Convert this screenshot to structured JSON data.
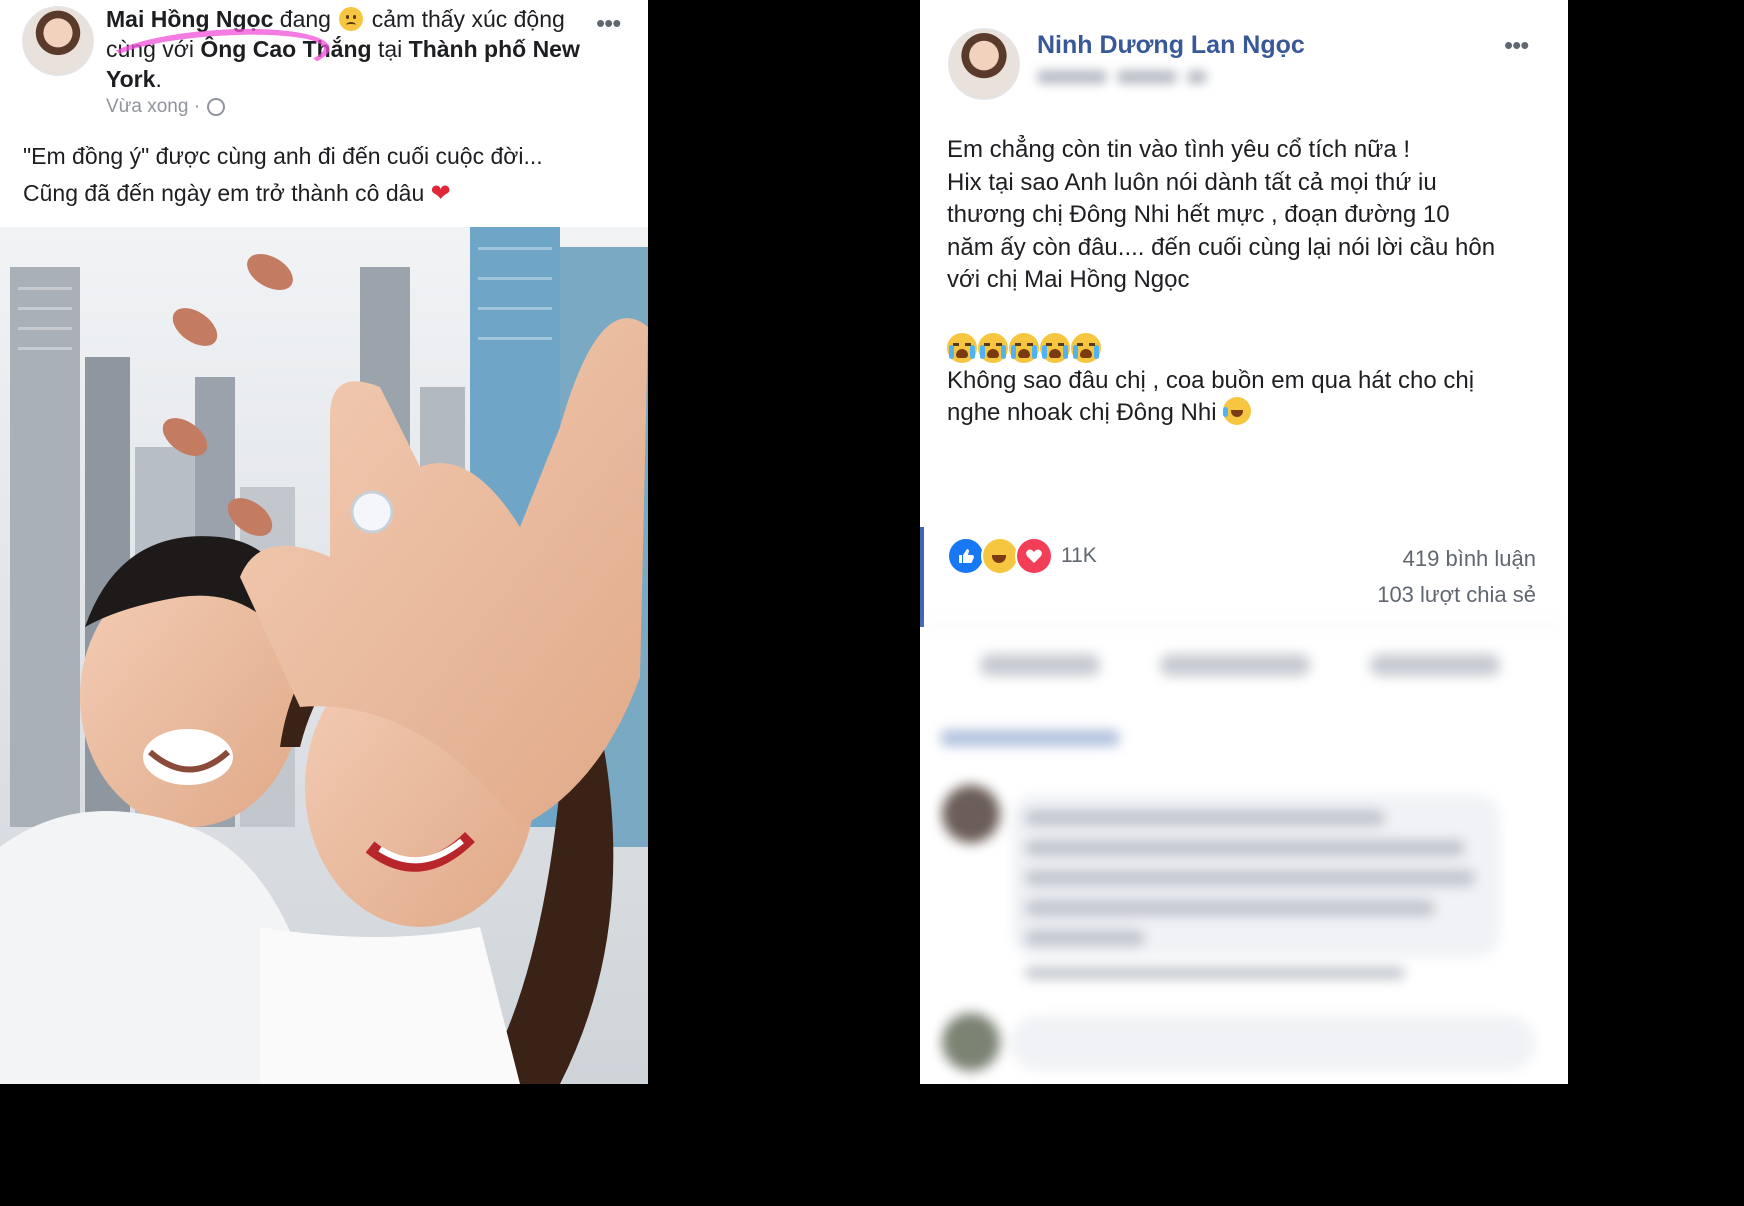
{
  "left_post": {
    "author": "Mai Hồng Ngọc",
    "feeling_prefix": "đang",
    "feeling_text": "cảm thấy xúc động",
    "with_text": "cùng với",
    "tagged": "Ông Cao Thắng",
    "at_text": "tại",
    "location": "Thành phố New York",
    "time": "Vừa xong",
    "separator": "·",
    "lines": [
      "\"Em đồng ý\" được cùng anh đi đến cuối cuộc đời...",
      "Cũng đã đến ngày em trở thành cô dâu"
    ],
    "heart": "❤",
    "more_icon": "•••"
  },
  "right_post": {
    "author": "Ninh Dương Lan Ngọc",
    "more_icon": "•••",
    "paragraph1": [
      "Em chẳng còn tin vào tình yêu cổ tích nữa !",
      "Hix tại sao Anh luôn nói dành tất cả mọi thứ iu",
      "thương chị Đông Nhi hết mực , đoạn đường 10",
      "năm ấy còn đâu.... đến cuối cùng lại nói lời cầu hôn",
      "với chị Mai Hồng Ngọc"
    ],
    "paragraph2": [
      "Không sao đâu chị , coa buồn em qua hát cho chị",
      "nghe nhoak chị Đông Nhi"
    ],
    "reaction_count": "11K",
    "comments": "419 bình luận",
    "shares": "103 lượt chia sẻ"
  },
  "colors": {
    "link_blue": "#385898",
    "highlight_pink": "#f04fd8",
    "like_blue": "#1877f2",
    "love_red": "#f33e58"
  }
}
